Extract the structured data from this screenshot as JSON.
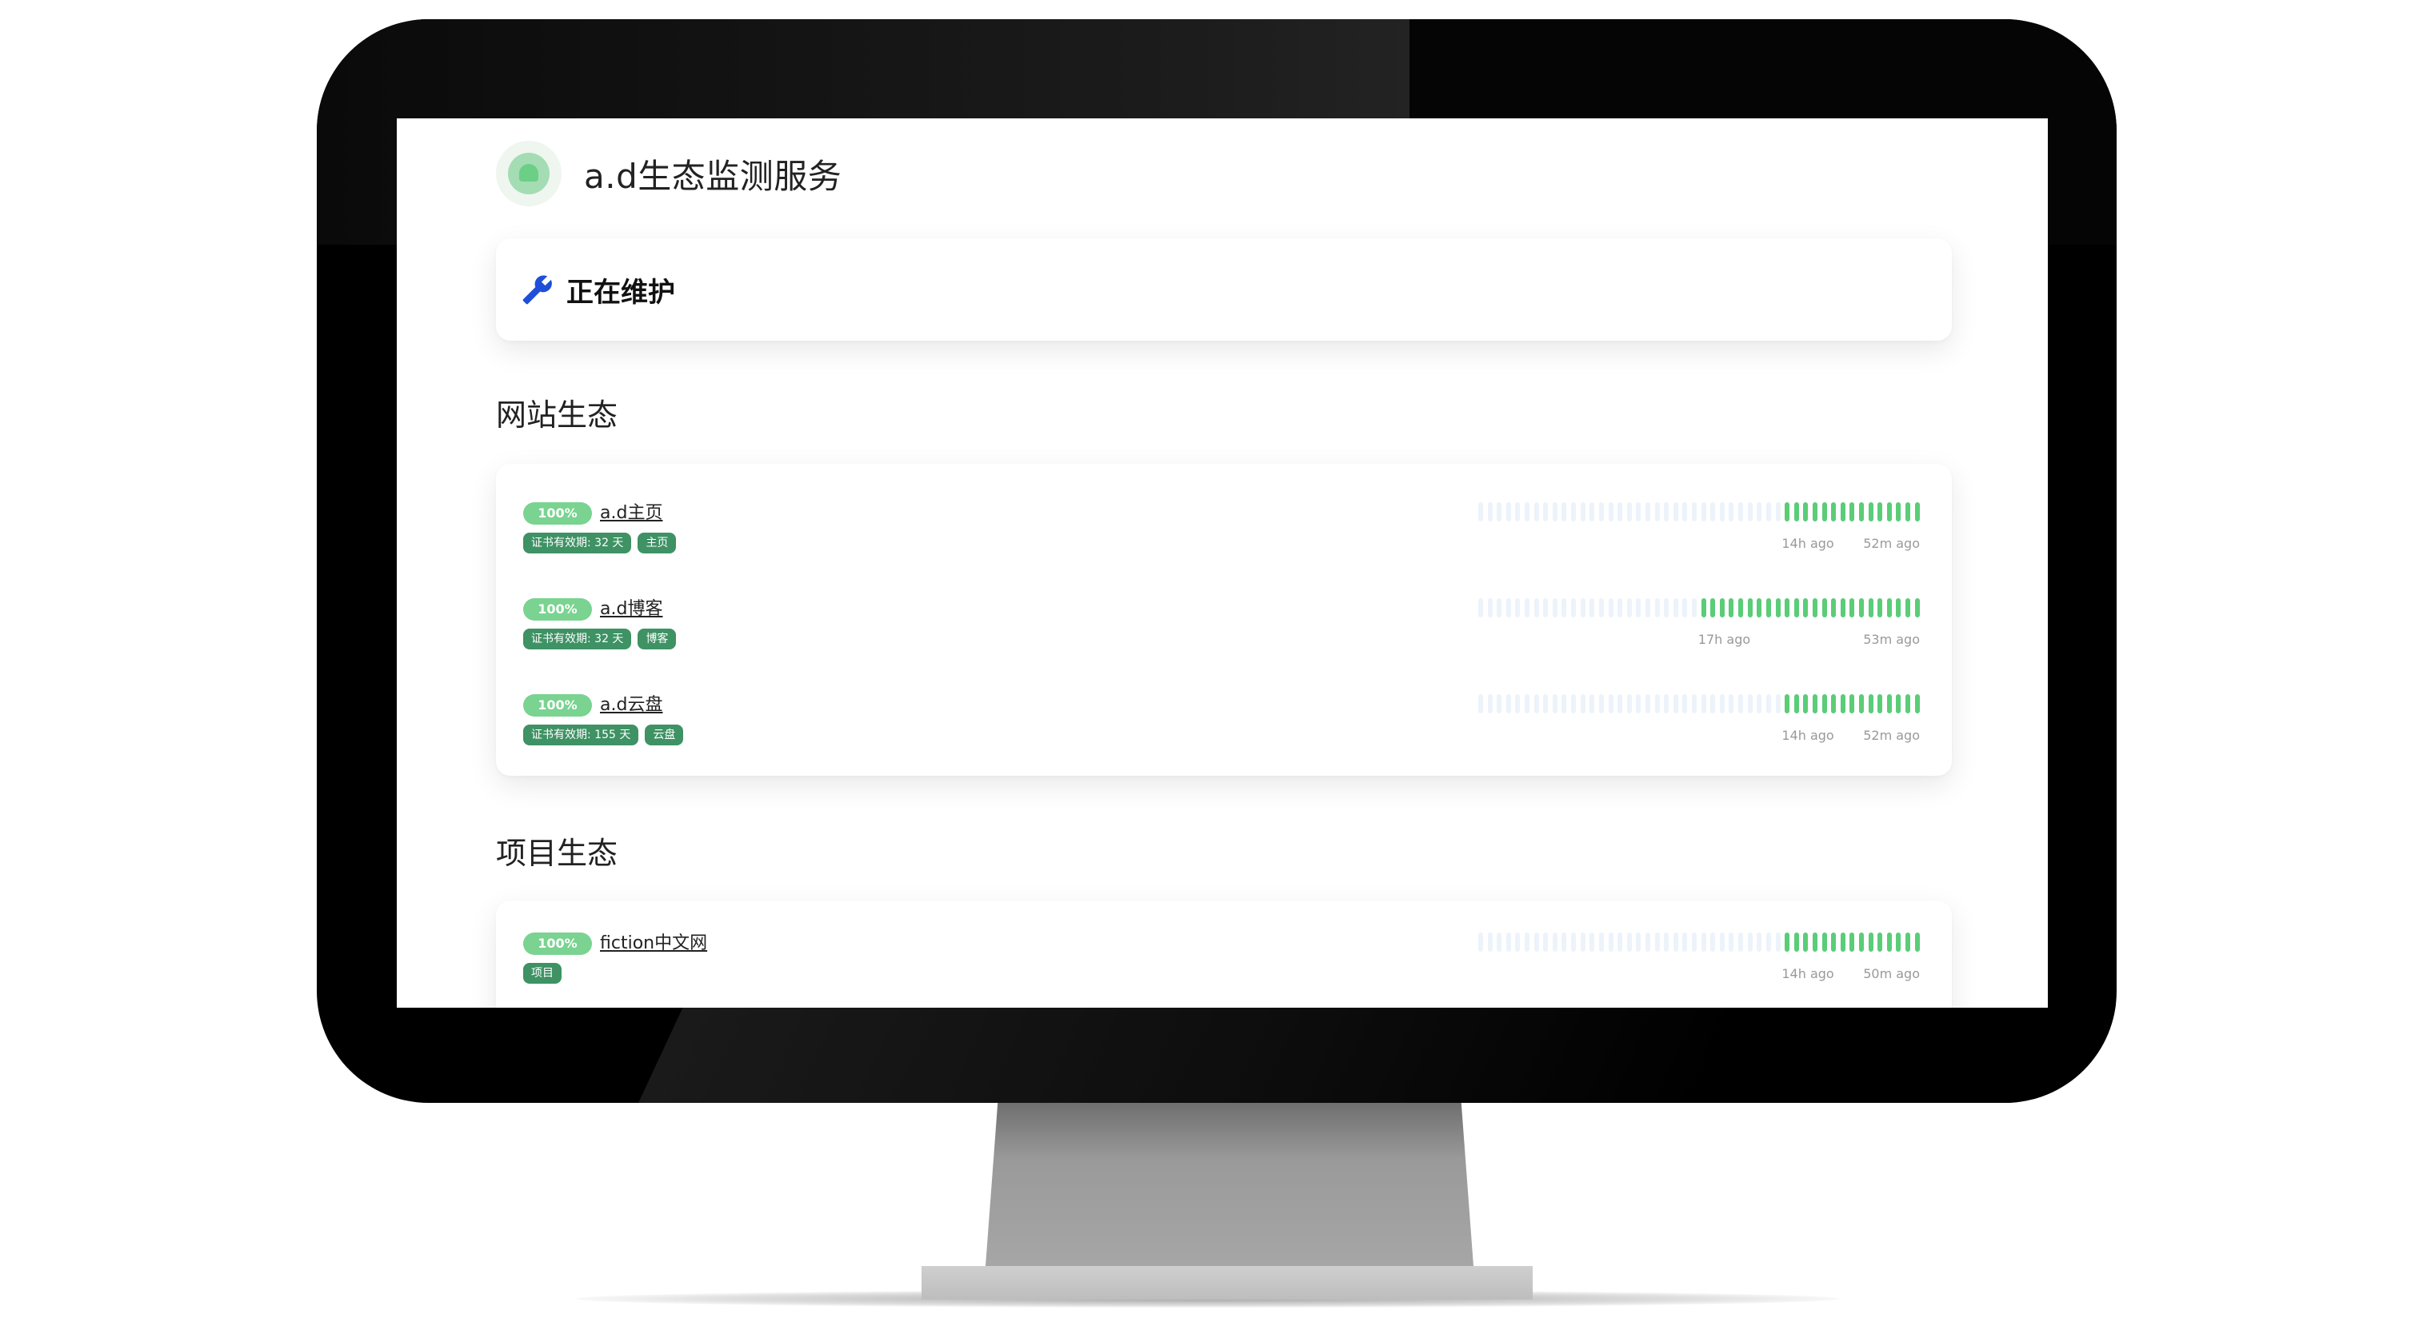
{
  "site": {
    "title": "a.d生态监测服务"
  },
  "maintenance": {
    "title": "正在维护",
    "icon": "wrench-icon",
    "icon_color": "#1f4fd8"
  },
  "groups": [
    {
      "title": "网站生态",
      "monitors": [
        {
          "uptime": "100%",
          "name": "a.d主页",
          "tags": [
            "证书有效期: 32 天",
            "主页"
          ],
          "beats_up": 15,
          "beats_total": 48,
          "time_start": "14h ago",
          "time_end": "52m ago"
        },
        {
          "uptime": "100%",
          "name": "a.d博客",
          "tags": [
            "证书有效期: 32 天",
            "博客"
          ],
          "beats_up": 24,
          "beats_total": 48,
          "time_start": "17h ago",
          "time_end": "53m ago"
        },
        {
          "uptime": "100%",
          "name": "a.d云盘",
          "tags": [
            "证书有效期: 155 天",
            "云盘"
          ],
          "beats_up": 15,
          "beats_total": 48,
          "time_start": "14h ago",
          "time_end": "52m ago"
        }
      ]
    },
    {
      "title": "项目生态",
      "monitors": [
        {
          "uptime": "100%",
          "name": "fiction中文网",
          "tags": [
            "项目"
          ],
          "beats_up": 15,
          "beats_total": 48,
          "time_start": "14h ago",
          "time_end": "50m ago"
        }
      ]
    }
  ],
  "colors": {
    "beat_up": "#5bcc78",
    "beat_empty": "#ecf3fa",
    "uptime_badge": "#7ad391",
    "tag": "#3e9264"
  }
}
